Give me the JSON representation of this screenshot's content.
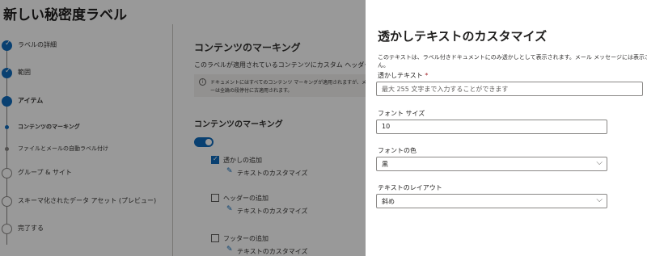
{
  "page": {
    "title": "新しい秘密度ラベル"
  },
  "steps": [
    {
      "label": "ラベルの詳細",
      "state": "done"
    },
    {
      "label": "範囲",
      "state": "done"
    },
    {
      "label": "アイテム",
      "state": "current"
    },
    {
      "label": "コンテンツのマーキング",
      "state": "sub-active"
    },
    {
      "label": "ファイルとメールの自動ラベル付け",
      "state": "sub"
    },
    {
      "label": "グループ & サイト",
      "state": "pending"
    },
    {
      "label": "スキーマ化されたデータ アセット (プレビュー)",
      "state": "pending"
    },
    {
      "label": "完了する",
      "state": "pending"
    }
  ],
  "main": {
    "heading": "コンテンツのマーキング",
    "description": "このラベルが適用されているコンテンツにカスタム ヘッダー、フ",
    "info_line1": "ドキュメントにはすべてのコンテンツ マーキングが適用されますが、メール ↗",
    "info_line2": "ーは全論の段停付に古適用されます。",
    "section_heading": "コンテンツのマーキング",
    "options": [
      {
        "label": "透かしの追加",
        "checked": true,
        "link": "テキストのカスタマイズ"
      },
      {
        "label": "ヘッダーの追加",
        "checked": false,
        "link": "テキストのカスタマイズ"
      },
      {
        "label": "フッターの追加",
        "checked": false,
        "link": "テキストのカスタマイズ"
      }
    ]
  },
  "panel": {
    "title": "透かしテキストのカスタマイズ",
    "desc_line1": "このテキストは、ラベル付きドキュメントにのみ透かしとして表示されます。メール メッセージには表示されませ",
    "desc_line2": "ん。",
    "watermark_label": "透かしテキスト",
    "required_mark": "*",
    "watermark_placeholder": "最大 255 文字まで入力することができます",
    "font_size_label": "フォント サイズ",
    "font_size_value": "10",
    "font_color_label": "フォントの色",
    "font_color_value": "黒",
    "layout_label": "テキストのレイアウト",
    "layout_value": "斜め"
  },
  "icons": {
    "check": "✓",
    "pencil": "✎",
    "chevron": "⌵",
    "info": "i"
  },
  "colors": {
    "accent": "#0f6cbd",
    "overlay": "rgba(0,0,0,0.4)",
    "required": "#a4262c"
  }
}
